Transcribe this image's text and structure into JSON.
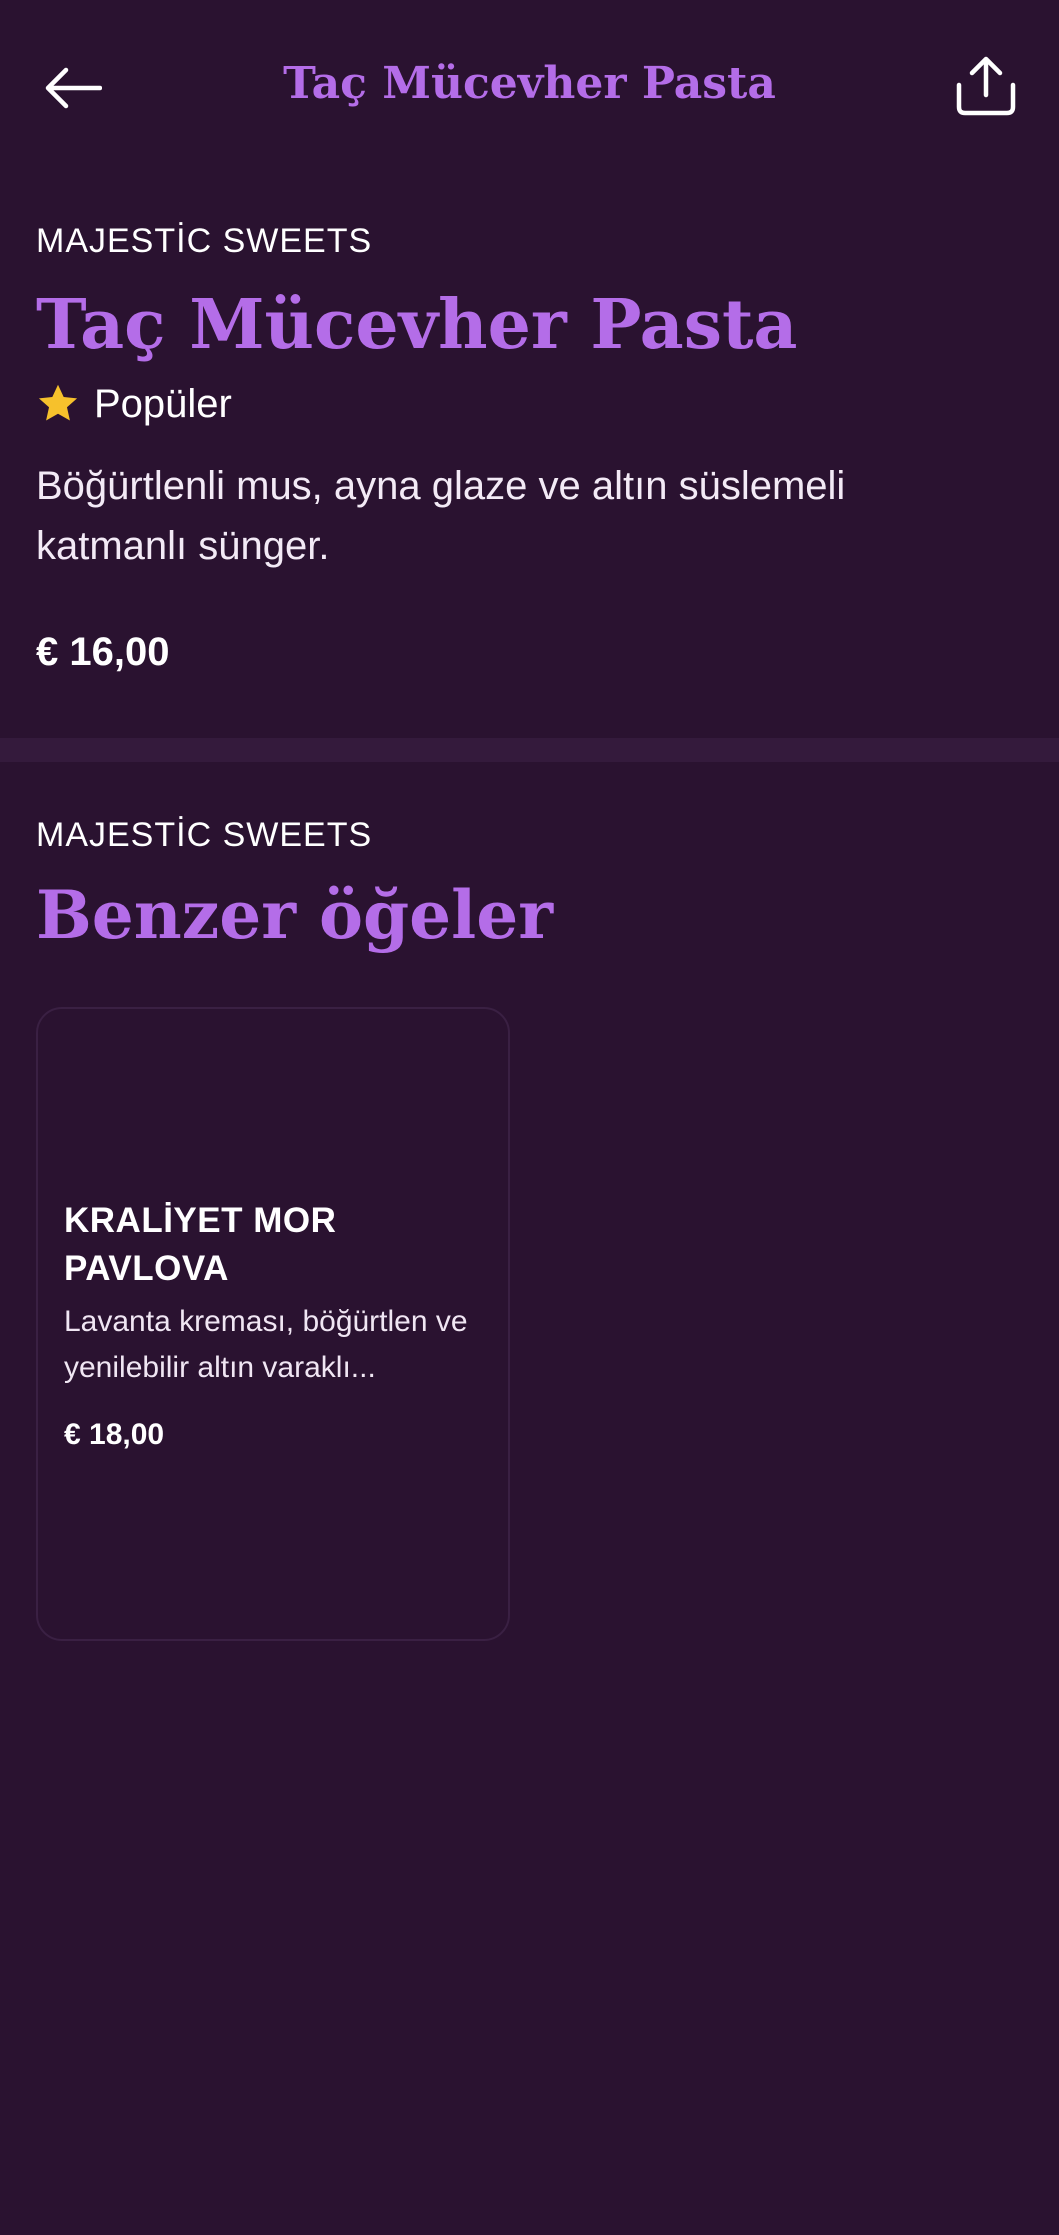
{
  "header": {
    "title": "Taç Mücevher Pasta",
    "back_icon": "arrow-left-icon",
    "share_icon": "share-icon"
  },
  "product": {
    "brand": "MAJESTİC SWEETS",
    "title": "Taç Mücevher Pasta",
    "badge": "Popüler",
    "badge_icon": "star-icon",
    "description": "Böğürtlenli mus, ayna glaze ve altın süslemeli katmanlı sünger.",
    "price": "€ 16,00"
  },
  "similar": {
    "brand": "MAJESTİC SWEETS",
    "title": "Benzer öğeler",
    "items": [
      {
        "title": "KRALİYET MOR PAVLOVA",
        "description": "Lavanta kreması, böğürtlen ve yenilebilir altın varaklı...",
        "price": "€ 18,00"
      }
    ]
  },
  "colors": {
    "background": "#2a1230",
    "accent": "#b46de8",
    "star": "#f6c12c",
    "divider": "#341a3c"
  }
}
